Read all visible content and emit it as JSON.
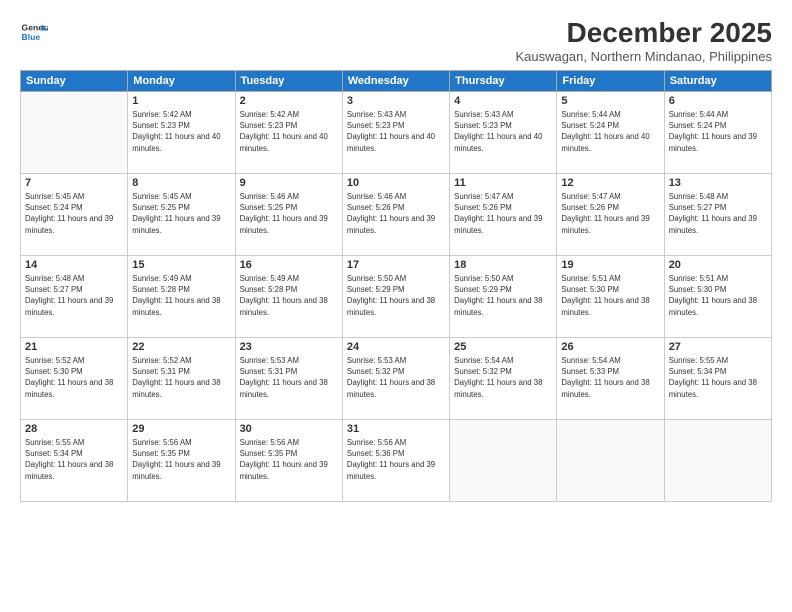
{
  "header": {
    "logo_line1": "General",
    "logo_line2": "Blue",
    "title": "December 2025",
    "subtitle": "Kauswagan, Northern Mindanao, Philippines"
  },
  "weekdays": [
    "Sunday",
    "Monday",
    "Tuesday",
    "Wednesday",
    "Thursday",
    "Friday",
    "Saturday"
  ],
  "weeks": [
    [
      {
        "day": "",
        "sunrise": "",
        "sunset": "",
        "daylight": ""
      },
      {
        "day": "1",
        "sunrise": "Sunrise: 5:42 AM",
        "sunset": "Sunset: 5:23 PM",
        "daylight": "Daylight: 11 hours and 40 minutes."
      },
      {
        "day": "2",
        "sunrise": "Sunrise: 5:42 AM",
        "sunset": "Sunset: 5:23 PM",
        "daylight": "Daylight: 11 hours and 40 minutes."
      },
      {
        "day": "3",
        "sunrise": "Sunrise: 5:43 AM",
        "sunset": "Sunset: 5:23 PM",
        "daylight": "Daylight: 11 hours and 40 minutes."
      },
      {
        "day": "4",
        "sunrise": "Sunrise: 5:43 AM",
        "sunset": "Sunset: 5:23 PM",
        "daylight": "Daylight: 11 hours and 40 minutes."
      },
      {
        "day": "5",
        "sunrise": "Sunrise: 5:44 AM",
        "sunset": "Sunset: 5:24 PM",
        "daylight": "Daylight: 11 hours and 40 minutes."
      },
      {
        "day": "6",
        "sunrise": "Sunrise: 5:44 AM",
        "sunset": "Sunset: 5:24 PM",
        "daylight": "Daylight: 11 hours and 39 minutes."
      }
    ],
    [
      {
        "day": "7",
        "sunrise": "Sunrise: 5:45 AM",
        "sunset": "Sunset: 5:24 PM",
        "daylight": "Daylight: 11 hours and 39 minutes."
      },
      {
        "day": "8",
        "sunrise": "Sunrise: 5:45 AM",
        "sunset": "Sunset: 5:25 PM",
        "daylight": "Daylight: 11 hours and 39 minutes."
      },
      {
        "day": "9",
        "sunrise": "Sunrise: 5:46 AM",
        "sunset": "Sunset: 5:25 PM",
        "daylight": "Daylight: 11 hours and 39 minutes."
      },
      {
        "day": "10",
        "sunrise": "Sunrise: 5:46 AM",
        "sunset": "Sunset: 5:26 PM",
        "daylight": "Daylight: 11 hours and 39 minutes."
      },
      {
        "day": "11",
        "sunrise": "Sunrise: 5:47 AM",
        "sunset": "Sunset: 5:26 PM",
        "daylight": "Daylight: 11 hours and 39 minutes."
      },
      {
        "day": "12",
        "sunrise": "Sunrise: 5:47 AM",
        "sunset": "Sunset: 5:26 PM",
        "daylight": "Daylight: 11 hours and 39 minutes."
      },
      {
        "day": "13",
        "sunrise": "Sunrise: 5:48 AM",
        "sunset": "Sunset: 5:27 PM",
        "daylight": "Daylight: 11 hours and 39 minutes."
      }
    ],
    [
      {
        "day": "14",
        "sunrise": "Sunrise: 5:48 AM",
        "sunset": "Sunset: 5:27 PM",
        "daylight": "Daylight: 11 hours and 39 minutes."
      },
      {
        "day": "15",
        "sunrise": "Sunrise: 5:49 AM",
        "sunset": "Sunset: 5:28 PM",
        "daylight": "Daylight: 11 hours and 38 minutes."
      },
      {
        "day": "16",
        "sunrise": "Sunrise: 5:49 AM",
        "sunset": "Sunset: 5:28 PM",
        "daylight": "Daylight: 11 hours and 38 minutes."
      },
      {
        "day": "17",
        "sunrise": "Sunrise: 5:50 AM",
        "sunset": "Sunset: 5:29 PM",
        "daylight": "Daylight: 11 hours and 38 minutes."
      },
      {
        "day": "18",
        "sunrise": "Sunrise: 5:50 AM",
        "sunset": "Sunset: 5:29 PM",
        "daylight": "Daylight: 11 hours and 38 minutes."
      },
      {
        "day": "19",
        "sunrise": "Sunrise: 5:51 AM",
        "sunset": "Sunset: 5:30 PM",
        "daylight": "Daylight: 11 hours and 38 minutes."
      },
      {
        "day": "20",
        "sunrise": "Sunrise: 5:51 AM",
        "sunset": "Sunset: 5:30 PM",
        "daylight": "Daylight: 11 hours and 38 minutes."
      }
    ],
    [
      {
        "day": "21",
        "sunrise": "Sunrise: 5:52 AM",
        "sunset": "Sunset: 5:30 PM",
        "daylight": "Daylight: 11 hours and 38 minutes."
      },
      {
        "day": "22",
        "sunrise": "Sunrise: 5:52 AM",
        "sunset": "Sunset: 5:31 PM",
        "daylight": "Daylight: 11 hours and 38 minutes."
      },
      {
        "day": "23",
        "sunrise": "Sunrise: 5:53 AM",
        "sunset": "Sunset: 5:31 PM",
        "daylight": "Daylight: 11 hours and 38 minutes."
      },
      {
        "day": "24",
        "sunrise": "Sunrise: 5:53 AM",
        "sunset": "Sunset: 5:32 PM",
        "daylight": "Daylight: 11 hours and 38 minutes."
      },
      {
        "day": "25",
        "sunrise": "Sunrise: 5:54 AM",
        "sunset": "Sunset: 5:32 PM",
        "daylight": "Daylight: 11 hours and 38 minutes."
      },
      {
        "day": "26",
        "sunrise": "Sunrise: 5:54 AM",
        "sunset": "Sunset: 5:33 PM",
        "daylight": "Daylight: 11 hours and 38 minutes."
      },
      {
        "day": "27",
        "sunrise": "Sunrise: 5:55 AM",
        "sunset": "Sunset: 5:34 PM",
        "daylight": "Daylight: 11 hours and 38 minutes."
      }
    ],
    [
      {
        "day": "28",
        "sunrise": "Sunrise: 5:55 AM",
        "sunset": "Sunset: 5:34 PM",
        "daylight": "Daylight: 11 hours and 38 minutes."
      },
      {
        "day": "29",
        "sunrise": "Sunrise: 5:56 AM",
        "sunset": "Sunset: 5:35 PM",
        "daylight": "Daylight: 11 hours and 39 minutes."
      },
      {
        "day": "30",
        "sunrise": "Sunrise: 5:56 AM",
        "sunset": "Sunset: 5:35 PM",
        "daylight": "Daylight: 11 hours and 39 minutes."
      },
      {
        "day": "31",
        "sunrise": "Sunrise: 5:56 AM",
        "sunset": "Sunset: 5:36 PM",
        "daylight": "Daylight: 11 hours and 39 minutes."
      },
      {
        "day": "",
        "sunrise": "",
        "sunset": "",
        "daylight": ""
      },
      {
        "day": "",
        "sunrise": "",
        "sunset": "",
        "daylight": ""
      },
      {
        "day": "",
        "sunrise": "",
        "sunset": "",
        "daylight": ""
      }
    ]
  ]
}
